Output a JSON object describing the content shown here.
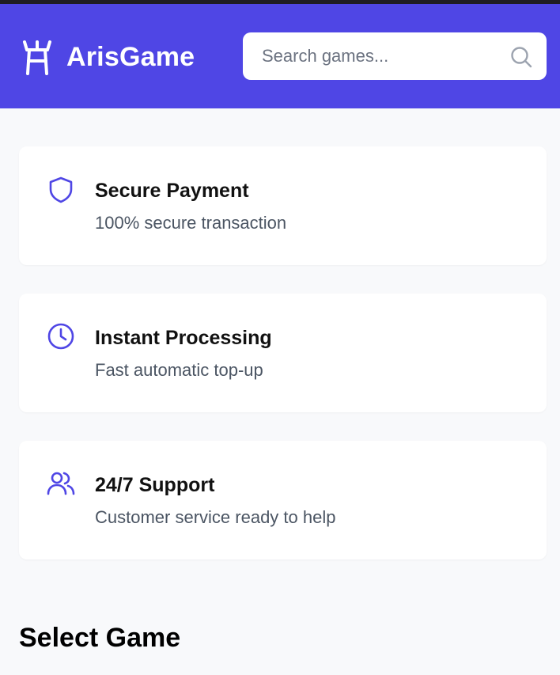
{
  "header": {
    "brand_name": "ArisGame",
    "logo_icon": "tower-icon",
    "background_color": "#4f46e5"
  },
  "search": {
    "placeholder": "Search games...",
    "value": "",
    "icon": "search-icon"
  },
  "features": [
    {
      "icon": "shield-icon",
      "title": "Secure Payment",
      "description": "100% secure transaction"
    },
    {
      "icon": "clock-icon",
      "title": "Instant Processing",
      "description": "Fast automatic top-up"
    },
    {
      "icon": "users-icon",
      "title": "24/7 Support",
      "description": "Customer service ready to help"
    }
  ],
  "games_section": {
    "title": "Select Game"
  },
  "colors": {
    "accent": "#4f46e5",
    "page_background": "#f8f9fb",
    "card_background": "#ffffff",
    "muted_text": "#4b5563"
  }
}
